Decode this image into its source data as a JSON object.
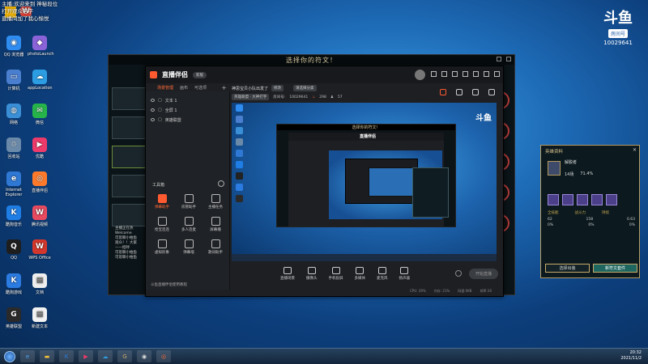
{
  "stream_overlay": {
    "line1": "主播:欢迎来到 神秘段位",
    "line2": "打开观众名字",
    "line3": "直播间加了我心愉悦"
  },
  "douyu_badge": {
    "logo": "斗鱼",
    "room_label": "房间号",
    "room_number": "10029641"
  },
  "desktop_icons": [
    {
      "label": "QQ 浏览器",
      "color": "#2f8cf0",
      "glyph": "◉"
    },
    {
      "label": "photoLaunch",
      "color": "#8b63d9",
      "glyph": "◆"
    },
    {
      "label": "计算机",
      "color": "#4a7fcf",
      "glyph": "▭"
    },
    {
      "label": "appLocation",
      "color": "#2c9de3",
      "glyph": "☁"
    },
    {
      "label": "网络",
      "color": "#3a8fd6",
      "glyph": "◍"
    },
    {
      "label": "微信",
      "color": "#26b34a",
      "glyph": "✉"
    },
    {
      "label": "回收站",
      "color": "#6b89a8",
      "glyph": "♲"
    },
    {
      "label": "优酷",
      "color": "#ee3a6a",
      "glyph": "▶"
    },
    {
      "label": "Internet Explorer",
      "color": "#2f78d4",
      "glyph": "e"
    },
    {
      "label": "直播伴侣",
      "color": "#ff7a2a",
      "glyph": "◎"
    },
    {
      "label": "酷狗音乐",
      "color": "#1e7ee6",
      "glyph": "K"
    },
    {
      "label": "腾讯视频",
      "color": "#e84a5f",
      "glyph": "W"
    },
    {
      "label": "QQ",
      "color": "#1e1e1e",
      "glyph": "Q"
    },
    {
      "label": "WPS Office",
      "color": "#d4372c",
      "glyph": "W"
    },
    {
      "label": "酷狗游戏",
      "color": "#2b7be0",
      "glyph": "K"
    },
    {
      "label": "文档",
      "color": "#eeeeee",
      "glyph": "▤"
    },
    {
      "label": "英雄联盟",
      "color": "#2a2a2a",
      "glyph": "G"
    },
    {
      "label": "新建文本",
      "color": "#f2f2f2",
      "glyph": "▤"
    }
  ],
  "game_window": {
    "title": "选择你的符文！",
    "chat_lines": [
      "主播正在热",
      "Welcome",
      "可思聊小柏鱼",
      "观众！！大家",
      "——招呼",
      "可思聊小柏鱼",
      "可思聊小柏鱼"
    ]
  },
  "streamer_app": {
    "app_name": "直播伴侣",
    "version_label": "新版",
    "tabs": [
      "场景管理",
      "画布",
      "可选项"
    ],
    "layers": [
      {
        "name": "文本 1"
      },
      {
        "name": "全屏 1"
      },
      {
        "name": "英雄联盟"
      }
    ],
    "tools_title": "工具箱",
    "tools": [
      {
        "label": "弹幕助手",
        "hot": true
      },
      {
        "label": "房管助手",
        "hot": false
      },
      {
        "label": "主播任务",
        "hot": false
      },
      {
        "label": "抢宝连连",
        "hot": false
      },
      {
        "label": "多人连麦",
        "hot": false
      },
      {
        "label": "屏幕播",
        "hot": false
      },
      {
        "label": "虚拟形象",
        "hot": false
      },
      {
        "label": "弹幕墙",
        "hot": false
      },
      {
        "label": "歌词助手",
        "hot": false
      }
    ],
    "bottom_left_text": "斗鱼直播伴侣使用教程",
    "room_title": "神思宝贝小队出发了",
    "edit_label": "修改",
    "category_label": "请选择分类",
    "game_tag": "英雄联盟 · 大神打字",
    "room_label": "房间号:",
    "room_number": "10029641",
    "hot_value": "298",
    "fans_value": "57",
    "controls": [
      {
        "label": "直播场景"
      },
      {
        "label": "摄像头"
      },
      {
        "label": "手机投屏"
      },
      {
        "label": "多媒体"
      },
      {
        "label": "麦克风"
      },
      {
        "label": "扬声器"
      }
    ],
    "start_button": "开始直播",
    "status_items": [
      "CPU: 29%",
      "内存: 21%",
      "网速:0KB",
      "帧率:30"
    ]
  },
  "hero_panel": {
    "title": "英雄资料",
    "champion": "解脱者",
    "games": "14场",
    "winrate": "71.4%",
    "stat_head": [
      "全技能",
      "战斗力",
      "持续"
    ],
    "stats": [
      "62",
      "158",
      "0.63",
      "0%",
      "0%",
      "0%"
    ],
    "button_left": "选择出装",
    "button_right": "新符文套件"
  },
  "taskbar": {
    "time": "20:32",
    "date": "2021/11/2"
  }
}
